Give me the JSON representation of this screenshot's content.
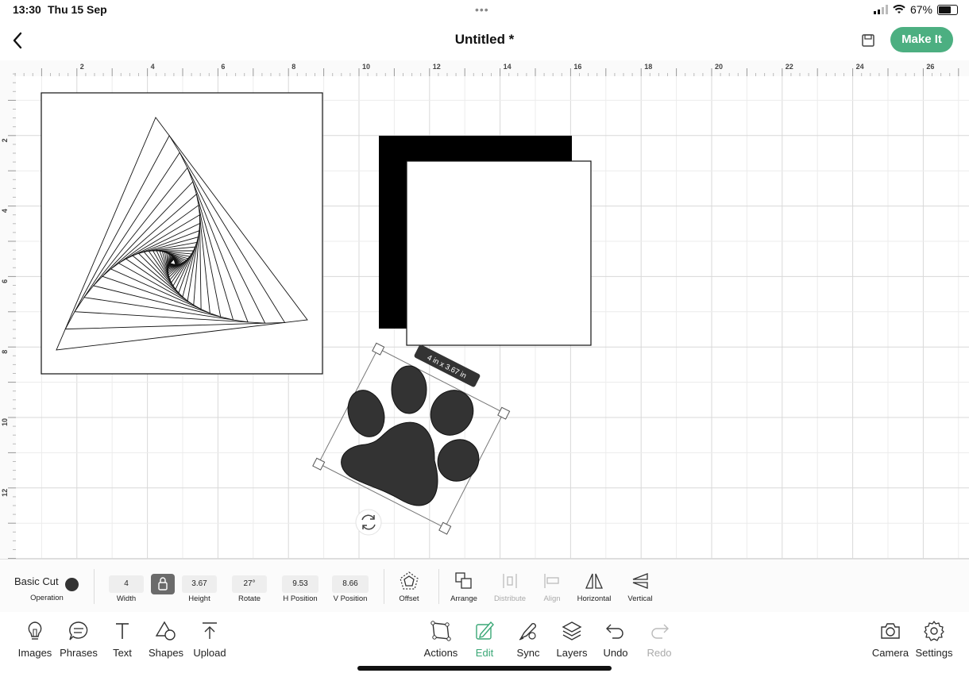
{
  "status": {
    "time": "13:30",
    "date": "Thu 15 Sep",
    "dots": "•••",
    "battery_text": "67%",
    "battery_level": 0.67
  },
  "header": {
    "title": "Untitled *",
    "make_it_label": "Make It",
    "back_icon": "chevron-left-icon",
    "save_icon": "save-icon"
  },
  "canvas": {
    "ruler_top_labels": [
      "2",
      "4",
      "6",
      "8",
      "10",
      "12",
      "14",
      "16",
      "18",
      "20",
      "22",
      "24",
      "26"
    ],
    "ruler_left_labels": [
      "2",
      "4",
      "6",
      "8",
      "10",
      "12"
    ],
    "size_label": "4 in x 3.67 in",
    "rotate_icon": "rotate-icon"
  },
  "toolbar": {
    "operation_value": "Basic Cut",
    "operation_label": "Operation",
    "width_value": "4",
    "width_label": "Width",
    "height_value": "3.67",
    "height_label": "Height",
    "rotate_value": "27°",
    "rotate_label": "Rotate",
    "hpos_value": "9.53",
    "hpos_label": "H Position",
    "vpos_value": "8.66",
    "vpos_label": "V Position",
    "offset_label": "Offset",
    "arrange_label": "Arrange",
    "distribute_label": "Distribute",
    "align_label": "Align",
    "horizontal_label": "Horizontal",
    "vertical_label": "Vertical"
  },
  "bottom_nav": {
    "images": "Images",
    "phrases": "Phrases",
    "text": "Text",
    "shapes": "Shapes",
    "upload": "Upload",
    "actions": "Actions",
    "edit": "Edit",
    "sync": "Sync",
    "layers": "Layers",
    "undo": "Undo",
    "redo": "Redo",
    "camera": "Camera",
    "settings": "Settings"
  },
  "colors": {
    "accent": "#4caf81",
    "edit_active": "#3aa776",
    "shape_fill": "#333333"
  }
}
